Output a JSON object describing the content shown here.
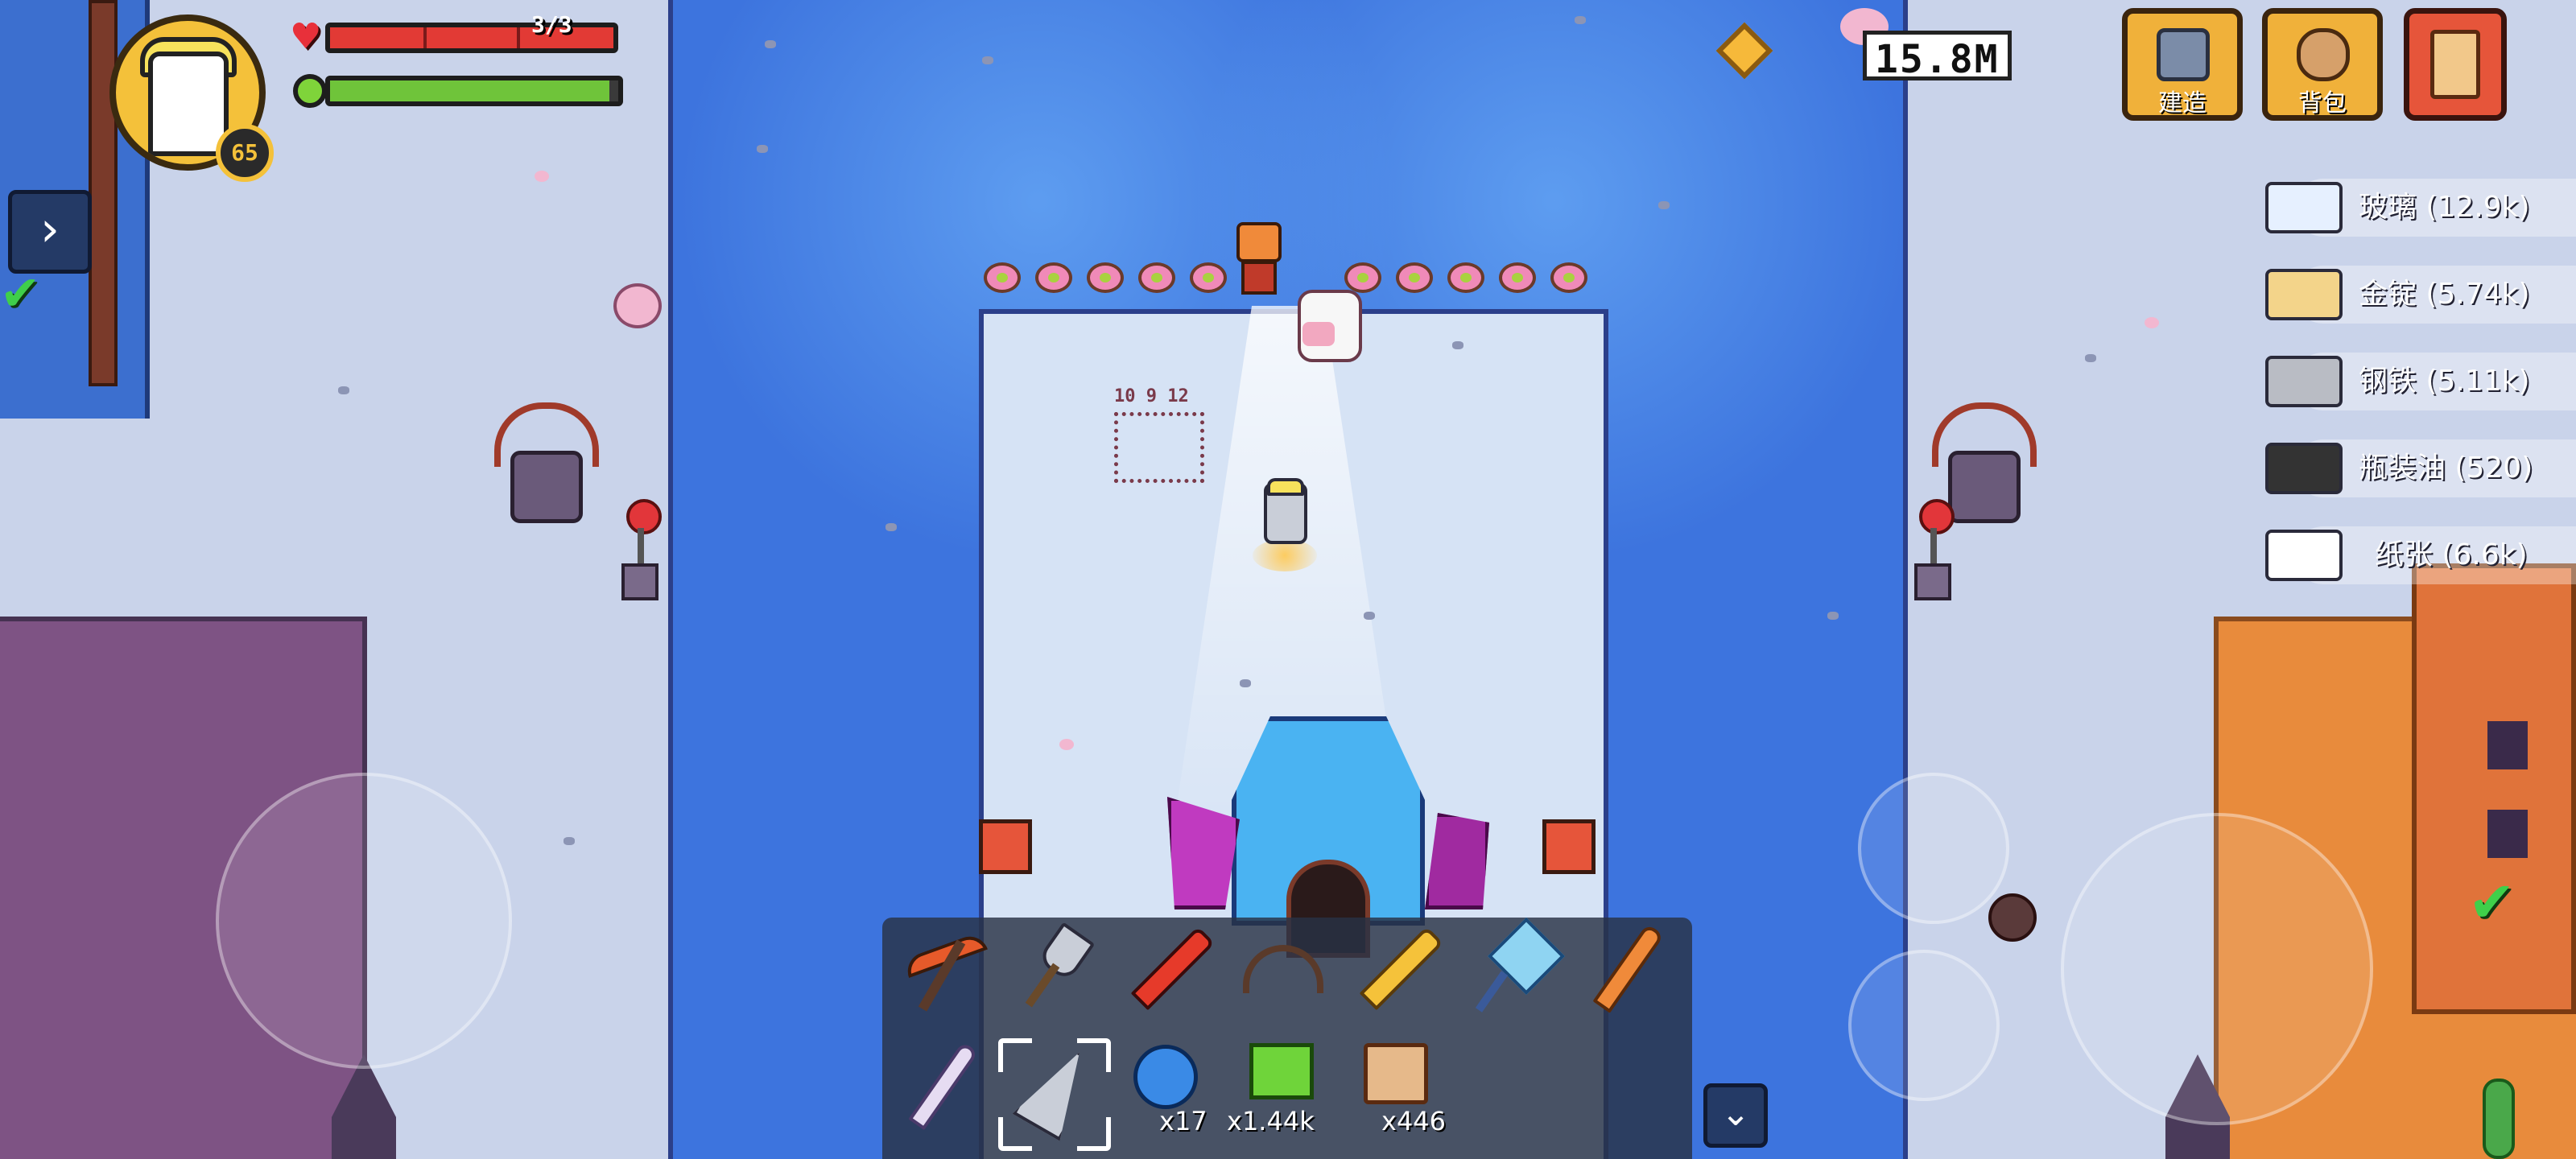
{
  "player": {
    "level": "65",
    "health_text": "3/3",
    "health_fraction": 1.0,
    "energy_fraction": 0.97
  },
  "currency": {
    "amount": "15.8M",
    "icon": "gold-diamond-icon"
  },
  "top_buttons": [
    {
      "label": "建造",
      "icon": "build-hammer-icon"
    },
    {
      "label": "背包",
      "icon": "backpack-bag-icon"
    },
    {
      "icon": "scroll-icon"
    }
  ],
  "resources": [
    {
      "name": "玻璃",
      "count": "(12.9k)",
      "icon": "glass-icon",
      "color": "#e6f0ff"
    },
    {
      "name": "金锭",
      "count": "(5.74k)",
      "icon": "gold-ingot-icon",
      "color": "#f3d48a"
    },
    {
      "name": "钢铁",
      "count": "(5.11k)",
      "icon": "steel-icon",
      "color": "#b9bcc4"
    },
    {
      "name": "瓶装油",
      "count": "(520)",
      "icon": "bottled-oil-icon",
      "color": "#333333"
    },
    {
      "name": "纸张",
      "count": "(6.6k)",
      "icon": "paper-icon",
      "color": "#ffffff"
    }
  ],
  "world": {
    "sign_text": "10 9 12"
  },
  "hotbar": {
    "items": [
      {
        "icon": "pickaxe-icon"
      },
      {
        "icon": "shovel-icon"
      },
      {
        "icon": "fire-sword-icon"
      },
      {
        "icon": "crossbow-icon"
      },
      {
        "icon": "golden-sword-icon"
      },
      {
        "icon": "crystal-axe-icon"
      },
      {
        "icon": "fire-spear-icon"
      },
      {
        "icon": "skeleton-staff-icon"
      },
      {
        "icon": "drill-icon"
      },
      {
        "icon": "blue-orb-icon",
        "count": "x17"
      },
      {
        "icon": "green-block-icon",
        "count": "x1.44k"
      },
      {
        "icon": "map-scroll-icon",
        "count": "x446"
      }
    ]
  },
  "colors": {
    "water": "#3d74de",
    "health": "#e23a35",
    "energy": "#6fc43a",
    "button_gold": "#f0b13a",
    "button_red": "#e6553a"
  }
}
